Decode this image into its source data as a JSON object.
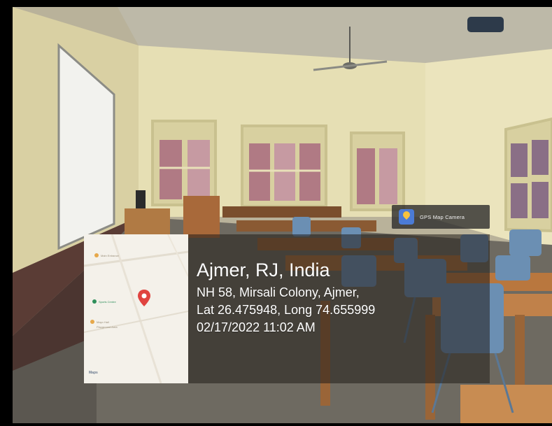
{
  "stamp": {
    "app_name": "GPS Map Camera",
    "app_icon": "gps-map-camera-app-icon",
    "location_title": "Ajmer, RJ, India",
    "address": "NH 58, Mirsali Colony, Ajmer,",
    "coordinates": "Lat 26.475948, Long 74.655999",
    "datetime": "02/17/2022 11:02 AM"
  },
  "map": {
    "labels": [
      "Main Entrance",
      "Sports Centre",
      "Mayo Hall",
      "Playground Area"
    ],
    "marker_icon": "map-pin-icon",
    "marker_color": "#e0433f",
    "logo_text": "Maps"
  },
  "colors": {
    "wall": "#e6dfb4",
    "dado": "#5a3c35",
    "floor": "#6e6a61",
    "desk_wood": "#b9773e",
    "chair_blue": "#6b8fb3",
    "overlay": "rgba(35,30,25,0.55)"
  }
}
